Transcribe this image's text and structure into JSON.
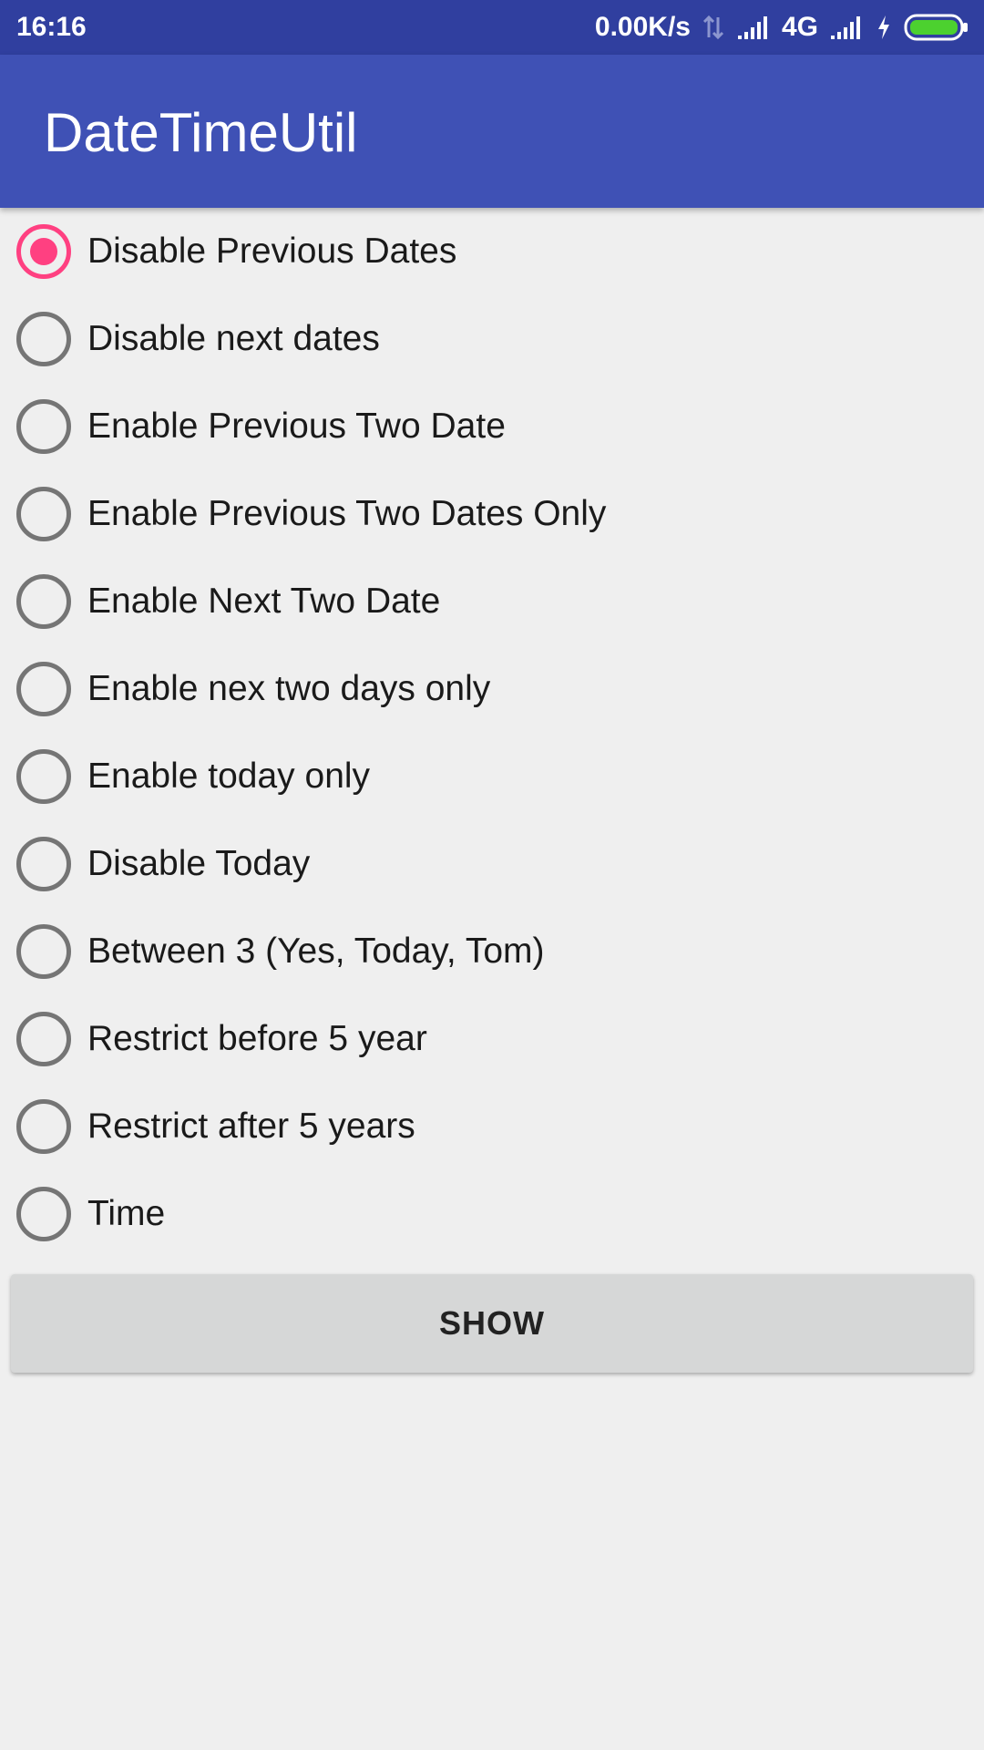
{
  "status_bar": {
    "time": "16:16",
    "net_speed": "0.00K/s",
    "network_type": "4G",
    "icons": [
      "data-transfer-icon",
      "signal-icon",
      "signal-icon",
      "charging-icon",
      "battery-icon"
    ],
    "background": "#303f9f"
  },
  "app_bar": {
    "title": "DateTimeUtil",
    "background": "#3f51b5"
  },
  "options": [
    {
      "label": "Disable Previous Dates",
      "checked": true
    },
    {
      "label": "Disable next dates",
      "checked": false
    },
    {
      "label": "Enable Previous Two Date",
      "checked": false
    },
    {
      "label": "Enable Previous Two Dates Only",
      "checked": false
    },
    {
      "label": "Enable Next Two Date",
      "checked": false
    },
    {
      "label": "Enable nex two days only",
      "checked": false
    },
    {
      "label": "Enable today only",
      "checked": false
    },
    {
      "label": "Disable Today",
      "checked": false
    },
    {
      "label": "Between 3 (Yes, Today, Tom)",
      "checked": false
    },
    {
      "label": "Restrict before 5 year",
      "checked": false
    },
    {
      "label": "Restrict after 5 years",
      "checked": false
    },
    {
      "label": "Time",
      "checked": false
    }
  ],
  "show_button": {
    "label": "SHOW"
  },
  "colors": {
    "accent": "#ff4081",
    "radio_unchecked": "#757575",
    "background": "#efefef",
    "button": "#d6d7d7"
  }
}
